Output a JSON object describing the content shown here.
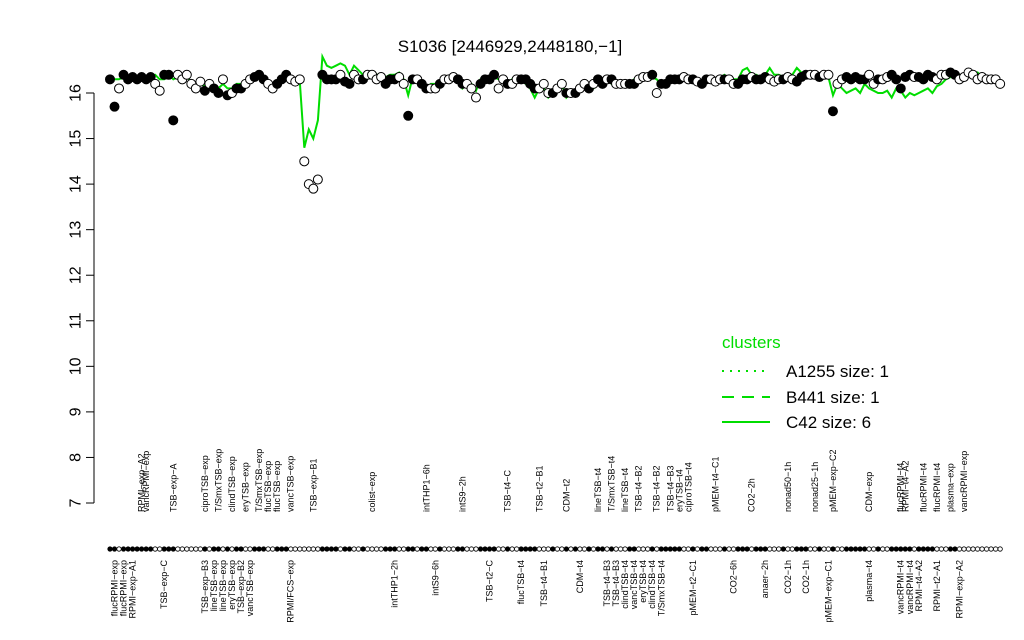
{
  "chart_data": {
    "type": "scatter",
    "title": "S1036 [2446929,2448180,−1]",
    "xlabel": "",
    "ylabel": "",
    "ylim": [
      7,
      16.7
    ],
    "yticks": [
      7,
      8,
      9,
      10,
      11,
      12,
      13,
      14,
      15,
      16
    ],
    "grid": false,
    "legend_title": "clusters",
    "legend_position": "right",
    "legend": [
      {
        "label": "A1255 size: 1",
        "style": "dotted"
      },
      {
        "label": "B441 size: 1",
        "style": "dashed"
      },
      {
        "label": "C42 size: 6",
        "style": "solid"
      }
    ],
    "line_color": "#00dd00",
    "x_count": 190,
    "top_labels": [
      {
        "x": 7,
        "text": "RPMI−exp−A2"
      },
      {
        "x": 8,
        "text": "vancRPMI−exp"
      },
      {
        "x": 14,
        "text": "TSB−exp−A"
      },
      {
        "x": 21,
        "text": "ciproTSB−exp"
      },
      {
        "x": 24,
        "text": "T/SmxTSB−exp"
      },
      {
        "x": 27,
        "text": "clindTSB−exp"
      },
      {
        "x": 30,
        "text": "eryTSB−exp"
      },
      {
        "x": 33,
        "text": "T/SmxTSB−exp"
      },
      {
        "x": 35,
        "text": "flucTSB−exp"
      },
      {
        "x": 37,
        "text": "flucTSB−exp"
      },
      {
        "x": 40,
        "text": "vancTSB−exp"
      },
      {
        "x": 45,
        "text": "TSB−exp−B1"
      },
      {
        "x": 58,
        "text": "colist−exp"
      },
      {
        "x": 70,
        "text": "intTHP1−6h"
      },
      {
        "x": 78,
        "text": "intS9−2h"
      },
      {
        "x": 88,
        "text": "TSB−t4−C"
      },
      {
        "x": 95,
        "text": "TSB−t2−B1"
      },
      {
        "x": 101,
        "text": "CDM−t2"
      },
      {
        "x": 108,
        "text": "lineTSB−t4"
      },
      {
        "x": 111,
        "text": "T/SmxTSB−t4"
      },
      {
        "x": 114,
        "text": "lineTSB−t4"
      },
      {
        "x": 117,
        "text": "TSB−t4−B2"
      },
      {
        "x": 121,
        "text": "TSB−t4−B2"
      },
      {
        "x": 124,
        "text": "TSB−t4−B3"
      },
      {
        "x": 126,
        "text": "eryTSB−t4"
      },
      {
        "x": 128,
        "text": "ciproTSB−t4"
      },
      {
        "x": 134,
        "text": "pMEM−t4−C1"
      },
      {
        "x": 142,
        "text": "CO2−2h"
      },
      {
        "x": 150,
        "text": "nonad50−1h"
      },
      {
        "x": 156,
        "text": "nonad25−1h"
      },
      {
        "x": 160,
        "text": "pMEM−exp−C2"
      },
      {
        "x": 168,
        "text": "CDM−exp"
      },
      {
        "x": 175,
        "text": "flucRPMI−t4"
      },
      {
        "x": 176,
        "text": "RPMI−t4−A2"
      },
      {
        "x": 180,
        "text": "flucRPMI−t4"
      },
      {
        "x": 183,
        "text": "flucRPMI−t4"
      },
      {
        "x": 186,
        "text": "plasma−exp"
      },
      {
        "x": 189,
        "text": "vancRPMI−exp"
      }
    ],
    "bottom_labels": [
      {
        "x": 1,
        "text": "flucRPMI−exp"
      },
      {
        "x": 3,
        "text": "flucRPMI−exp"
      },
      {
        "x": 5,
        "text": "RPMI−exp−A1"
      },
      {
        "x": 12,
        "text": "TSB−exp−C"
      },
      {
        "x": 21,
        "text": "TSB−exp−B3"
      },
      {
        "x": 23,
        "text": "lineTSB−exp"
      },
      {
        "x": 25,
        "text": "lineTSB−exp"
      },
      {
        "x": 27,
        "text": "eryTSB−exp"
      },
      {
        "x": 29,
        "text": "TSB−exp−B2"
      },
      {
        "x": 31,
        "text": "vancTSB−exp"
      },
      {
        "x": 40,
        "text": "RPMI/FCS−exp"
      },
      {
        "x": 63,
        "text": "intTHP1−2h"
      },
      {
        "x": 72,
        "text": "intS9−6h"
      },
      {
        "x": 84,
        "text": "TSB−t2−C"
      },
      {
        "x": 91,
        "text": "flucTSB−t4"
      },
      {
        "x": 96,
        "text": "TSB−t4−B1"
      },
      {
        "x": 104,
        "text": "CDM−t4"
      },
      {
        "x": 110,
        "text": "TSB−t4−B3"
      },
      {
        "x": 112,
        "text": "TSB−t4−B3"
      },
      {
        "x": 114,
        "text": "clindTSB−t4"
      },
      {
        "x": 116,
        "text": "vancTSB−t4"
      },
      {
        "x": 118,
        "text": "eryTSB−t4"
      },
      {
        "x": 120,
        "text": "clindTSB−t4"
      },
      {
        "x": 122,
        "text": "T/SmxTSB−t4"
      },
      {
        "x": 129,
        "text": "pMEM−t2−C1"
      },
      {
        "x": 138,
        "text": "CO2−6h"
      },
      {
        "x": 145,
        "text": "anaer−2h"
      },
      {
        "x": 150,
        "text": "CO2−1h"
      },
      {
        "x": 154,
        "text": "CO2−1h"
      },
      {
        "x": 159,
        "text": "pMEM−exp−C1"
      },
      {
        "x": 168,
        "text": "plasma−t4"
      },
      {
        "x": 175,
        "text": "vancRPMI−t4"
      },
      {
        "x": 177,
        "text": "vancRPMI−t4"
      },
      {
        "x": 179,
        "text": "RPMI−t4−A2"
      },
      {
        "x": 183,
        "text": "RPMI−t2−A1"
      },
      {
        "x": 188,
        "text": "RPMI−exp−A2"
      }
    ],
    "series": [
      {
        "name": "",
        "values": [
          16.3,
          15.7,
          16.1,
          16.4,
          16.3,
          16.35,
          16.3,
          16.35,
          16.3,
          16.35,
          16.2,
          16.05,
          16.4,
          16.4,
          15.4,
          16.4,
          16.3,
          16.4,
          16.2,
          16.1,
          16.25,
          16.05,
          16.2,
          16.1,
          16.0,
          16.3,
          15.95,
          16.0,
          16.1,
          16.1,
          16.2,
          16.3,
          16.35,
          16.4,
          16.3,
          16.2,
          16.1,
          16.2,
          16.3,
          16.4,
          16.3,
          16.25,
          16.3,
          14.5,
          14.0,
          13.9,
          14.1,
          16.4,
          16.3,
          16.3,
          16.3,
          16.4,
          16.25,
          16.2,
          16.4,
          16.3,
          16.3,
          16.4,
          16.4,
          16.3,
          16.35,
          16.2,
          16.3,
          16.3,
          16.35,
          16.2,
          15.5,
          16.3,
          16.3,
          16.2,
          16.1,
          16.1,
          16.1,
          16.2,
          16.3,
          16.3,
          16.35,
          16.3,
          16.2,
          16.2,
          16.1,
          15.9,
          16.2,
          16.3,
          16.3,
          16.4,
          16.1,
          16.3,
          16.2,
          16.2,
          16.3,
          16.3,
          16.3,
          16.2,
          16.1,
          16.1,
          16.2,
          16.0,
          16.0,
          16.1,
          16.2,
          16.0,
          16.0,
          16.0,
          16.1,
          16.2,
          16.1,
          16.2,
          16.3,
          16.2,
          16.3,
          16.3,
          16.2,
          16.2,
          16.2,
          16.2,
          16.2,
          16.3,
          16.35,
          16.35,
          16.4,
          16.0,
          16.2,
          16.2,
          16.3,
          16.3,
          16.3,
          16.35,
          16.3,
          16.3,
          16.25,
          16.2,
          16.3,
          16.3,
          16.25,
          16.3,
          16.3,
          16.3,
          16.2,
          16.2,
          16.3,
          16.3,
          16.35,
          16.3,
          16.3,
          16.35,
          16.3,
          16.25,
          16.3,
          16.3,
          16.35,
          16.3,
          16.25,
          16.35,
          16.4,
          16.4,
          16.4,
          16.35,
          16.4,
          16.4,
          15.6,
          16.2,
          16.3,
          16.35,
          16.3,
          16.35,
          16.3,
          16.3,
          16.4,
          16.2,
          16.3,
          16.3,
          16.35,
          16.4,
          16.3,
          16.1,
          16.35,
          16.4,
          16.35,
          16.35,
          16.3,
          16.4,
          16.35,
          16.3,
          16.4,
          16.4,
          16.45,
          16.4,
          16.3,
          16.35,
          16.45,
          16.4,
          16.3,
          16.35,
          16.3,
          16.3,
          16.3,
          16.2
        ],
        "filled": [
          1,
          1,
          0,
          1,
          1,
          1,
          1,
          1,
          1,
          1,
          0,
          0,
          1,
          1,
          1,
          0,
          0,
          0,
          0,
          0,
          0,
          1,
          0,
          1,
          1,
          0,
          1,
          0,
          1,
          1,
          0,
          0,
          1,
          1,
          1,
          0,
          0,
          1,
          1,
          1,
          0,
          0,
          0,
          0,
          0,
          0,
          0,
          1,
          1,
          1,
          1,
          0,
          1,
          1,
          0,
          0,
          1,
          0,
          0,
          0,
          0,
          1,
          1,
          1,
          0,
          0,
          1,
          1,
          0,
          1,
          1,
          0,
          0,
          1,
          0,
          0,
          0,
          1,
          1,
          0,
          0,
          0,
          1,
          1,
          1,
          1,
          0,
          0,
          1,
          0,
          0,
          1,
          1,
          1,
          1,
          0,
          0,
          0,
          1,
          0,
          0,
          1,
          0,
          1,
          0,
          0,
          1,
          0,
          1,
          1,
          0,
          1,
          0,
          0,
          0,
          1,
          1,
          0,
          0,
          0,
          1,
          0,
          1,
          1,
          1,
          1,
          1,
          0,
          0,
          1,
          0,
          1,
          1,
          0,
          0,
          0,
          1,
          0,
          0,
          1,
          1,
          1,
          0,
          1,
          1,
          1,
          0,
          0,
          0,
          1,
          0,
          0,
          1,
          1,
          1,
          0,
          0,
          1,
          0,
          0,
          1,
          0,
          0,
          1,
          1,
          1,
          1,
          1,
          0,
          0,
          1,
          0,
          0,
          1,
          1,
          1,
          1,
          1,
          0,
          1,
          1,
          1,
          1,
          0,
          0,
          0,
          1,
          1,
          0,
          0
        ]
      }
    ],
    "cluster_line": [
      16.3,
      16.3,
      16.3,
      16.35,
      16.3,
      16.3,
      16.35,
      16.35,
      16.3,
      16.35,
      16.4,
      16.3,
      16.3,
      16.4,
      16.3,
      16.35,
      16.3,
      16.4,
      16.2,
      16.15,
      16.2,
      16.15,
      16.2,
      16.1,
      16.1,
      16.2,
      16.1,
      16.1,
      16.2,
      16.2,
      16.25,
      16.3,
      16.3,
      16.4,
      16.3,
      16.25,
      16.2,
      16.2,
      16.3,
      16.35,
      16.3,
      16.3,
      16.25,
      14.8,
      15.2,
      15.0,
      15.4,
      16.8,
      16.6,
      16.55,
      16.6,
      16.65,
      16.6,
      16.4,
      16.6,
      16.5,
      16.4,
      16.45,
      16.4,
      16.4,
      16.4,
      16.35,
      16.4,
      16.4,
      16.45,
      16.3,
      15.95,
      16.35,
      16.3,
      16.2,
      16.1,
      16.2,
      16.2,
      16.25,
      16.3,
      16.3,
      16.3,
      16.3,
      16.1,
      16.2,
      16.2,
      16.05,
      16.3,
      16.3,
      16.3,
      16.35,
      16.3,
      16.3,
      16.2,
      16.3,
      16.3,
      16.3,
      16.2,
      16.1,
      15.9,
      16.1,
      16.1,
      15.9,
      16.0,
      16.1,
      16.2,
      15.9,
      16.0,
      16.0,
      16.1,
      16.15,
      16.1,
      16.1,
      16.2,
      16.2,
      16.3,
      16.2,
      16.2,
      16.2,
      16.2,
      16.2,
      16.3,
      16.3,
      16.35,
      16.35,
      16.35,
      16.3,
      16.2,
      16.2,
      16.3,
      16.3,
      16.3,
      16.35,
      16.3,
      16.3,
      16.3,
      16.25,
      16.3,
      16.3,
      16.3,
      16.35,
      16.4,
      16.3,
      16.3,
      16.3,
      16.5,
      16.55,
      16.4,
      16.4,
      16.35,
      16.4,
      16.55,
      16.4,
      16.4,
      16.35,
      16.35,
      16.4,
      16.55,
      16.45,
      16.4,
      16.4,
      16.4,
      16.35,
      16.4,
      16.35,
      15.95,
      16.2,
      16.1,
      16.0,
      16.05,
      16.1,
      16.0,
      16.2,
      16.1,
      16.05,
      16.0,
      16.0,
      16.05,
      15.9,
      16.1,
      16.05,
      15.9,
      16.0,
      15.95,
      16.0,
      16.05,
      16.1,
      16.0,
      16.15,
      16.2,
      16.3,
      16.35,
      16.35,
      16.4,
      16.35,
      16.45,
      16.4,
      16.45,
      16.35,
      16.3,
      16.35,
      16.3,
      16.3
    ]
  }
}
